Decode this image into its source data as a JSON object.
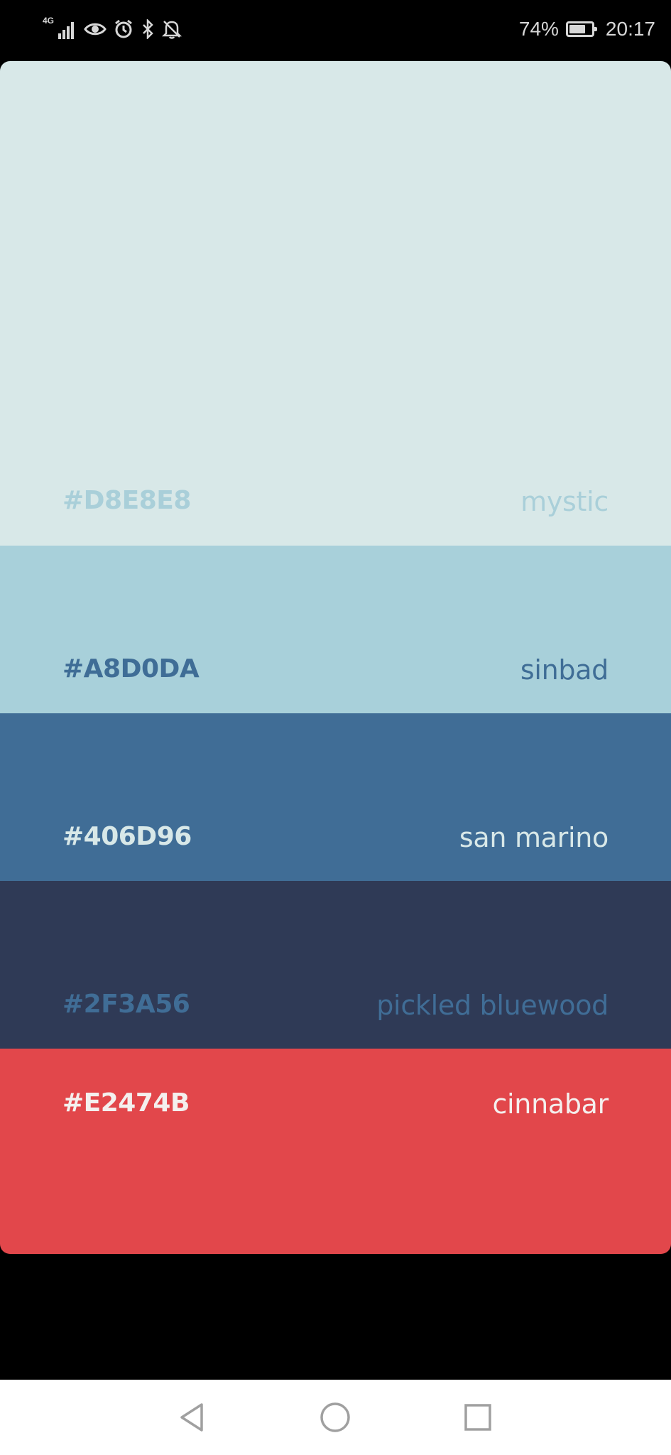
{
  "status_bar": {
    "network_type": "4G",
    "battery_percent_label": "74%",
    "battery_level": 0.74,
    "time": "20:17",
    "icons": [
      "signal-icon",
      "eye-icon",
      "alarm-icon",
      "bluetooth-icon",
      "bell-off-icon",
      "battery-icon"
    ],
    "color": "#d7d7d7"
  },
  "palette": {
    "swatches": [
      {
        "hex": "#D8E8E8",
        "name": "mystic",
        "color": "#D8E8E8",
        "text_color": "#a9cfd9"
      },
      {
        "hex": "#A8D0DA",
        "name": "sinbad",
        "color": "#A8D0DA",
        "text_color": "#3f6d96"
      },
      {
        "hex": "#406D96",
        "name": "san marino",
        "color": "#406D96",
        "text_color": "#d8e8e8"
      },
      {
        "hex": "#2F3A56",
        "name": "pickled bluewood",
        "color": "#2F3A56",
        "text_color": "#406d96"
      },
      {
        "hex": "#E2474B",
        "name": "cinnabar",
        "color": "#E2474B",
        "text_color": "#f4f0ee"
      }
    ]
  },
  "nav_bar": {
    "buttons": [
      "back-icon",
      "home-icon",
      "recents-icon"
    ],
    "background": "#ffffff",
    "icon_color": "#a0a0a0"
  }
}
